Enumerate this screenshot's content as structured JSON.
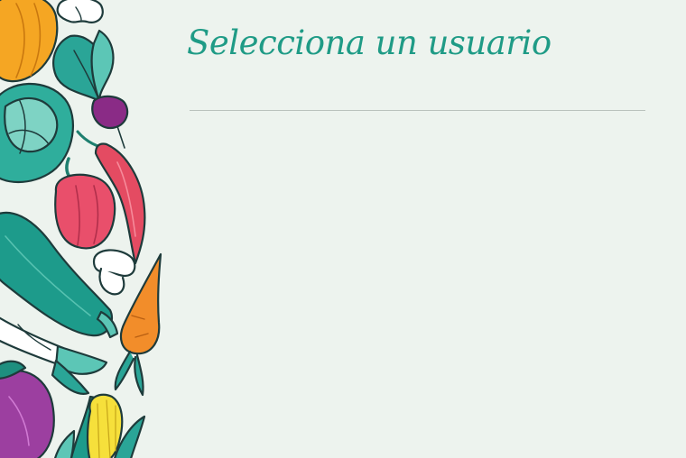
{
  "page": {
    "title": "Selecciona un usuario",
    "users": []
  },
  "colors": {
    "background": "#edf3ee",
    "title": "#1f9b86",
    "divider": "#b9c2bd"
  },
  "decoration": {
    "items": [
      "pumpkin-icon",
      "mushroom-icon",
      "radish-icon",
      "cabbage-icon",
      "chili-pepper-icon",
      "bell-pepper-icon",
      "zucchini-icon",
      "carrot-icon",
      "leek-icon",
      "eggplant-icon",
      "corn-icon"
    ]
  }
}
